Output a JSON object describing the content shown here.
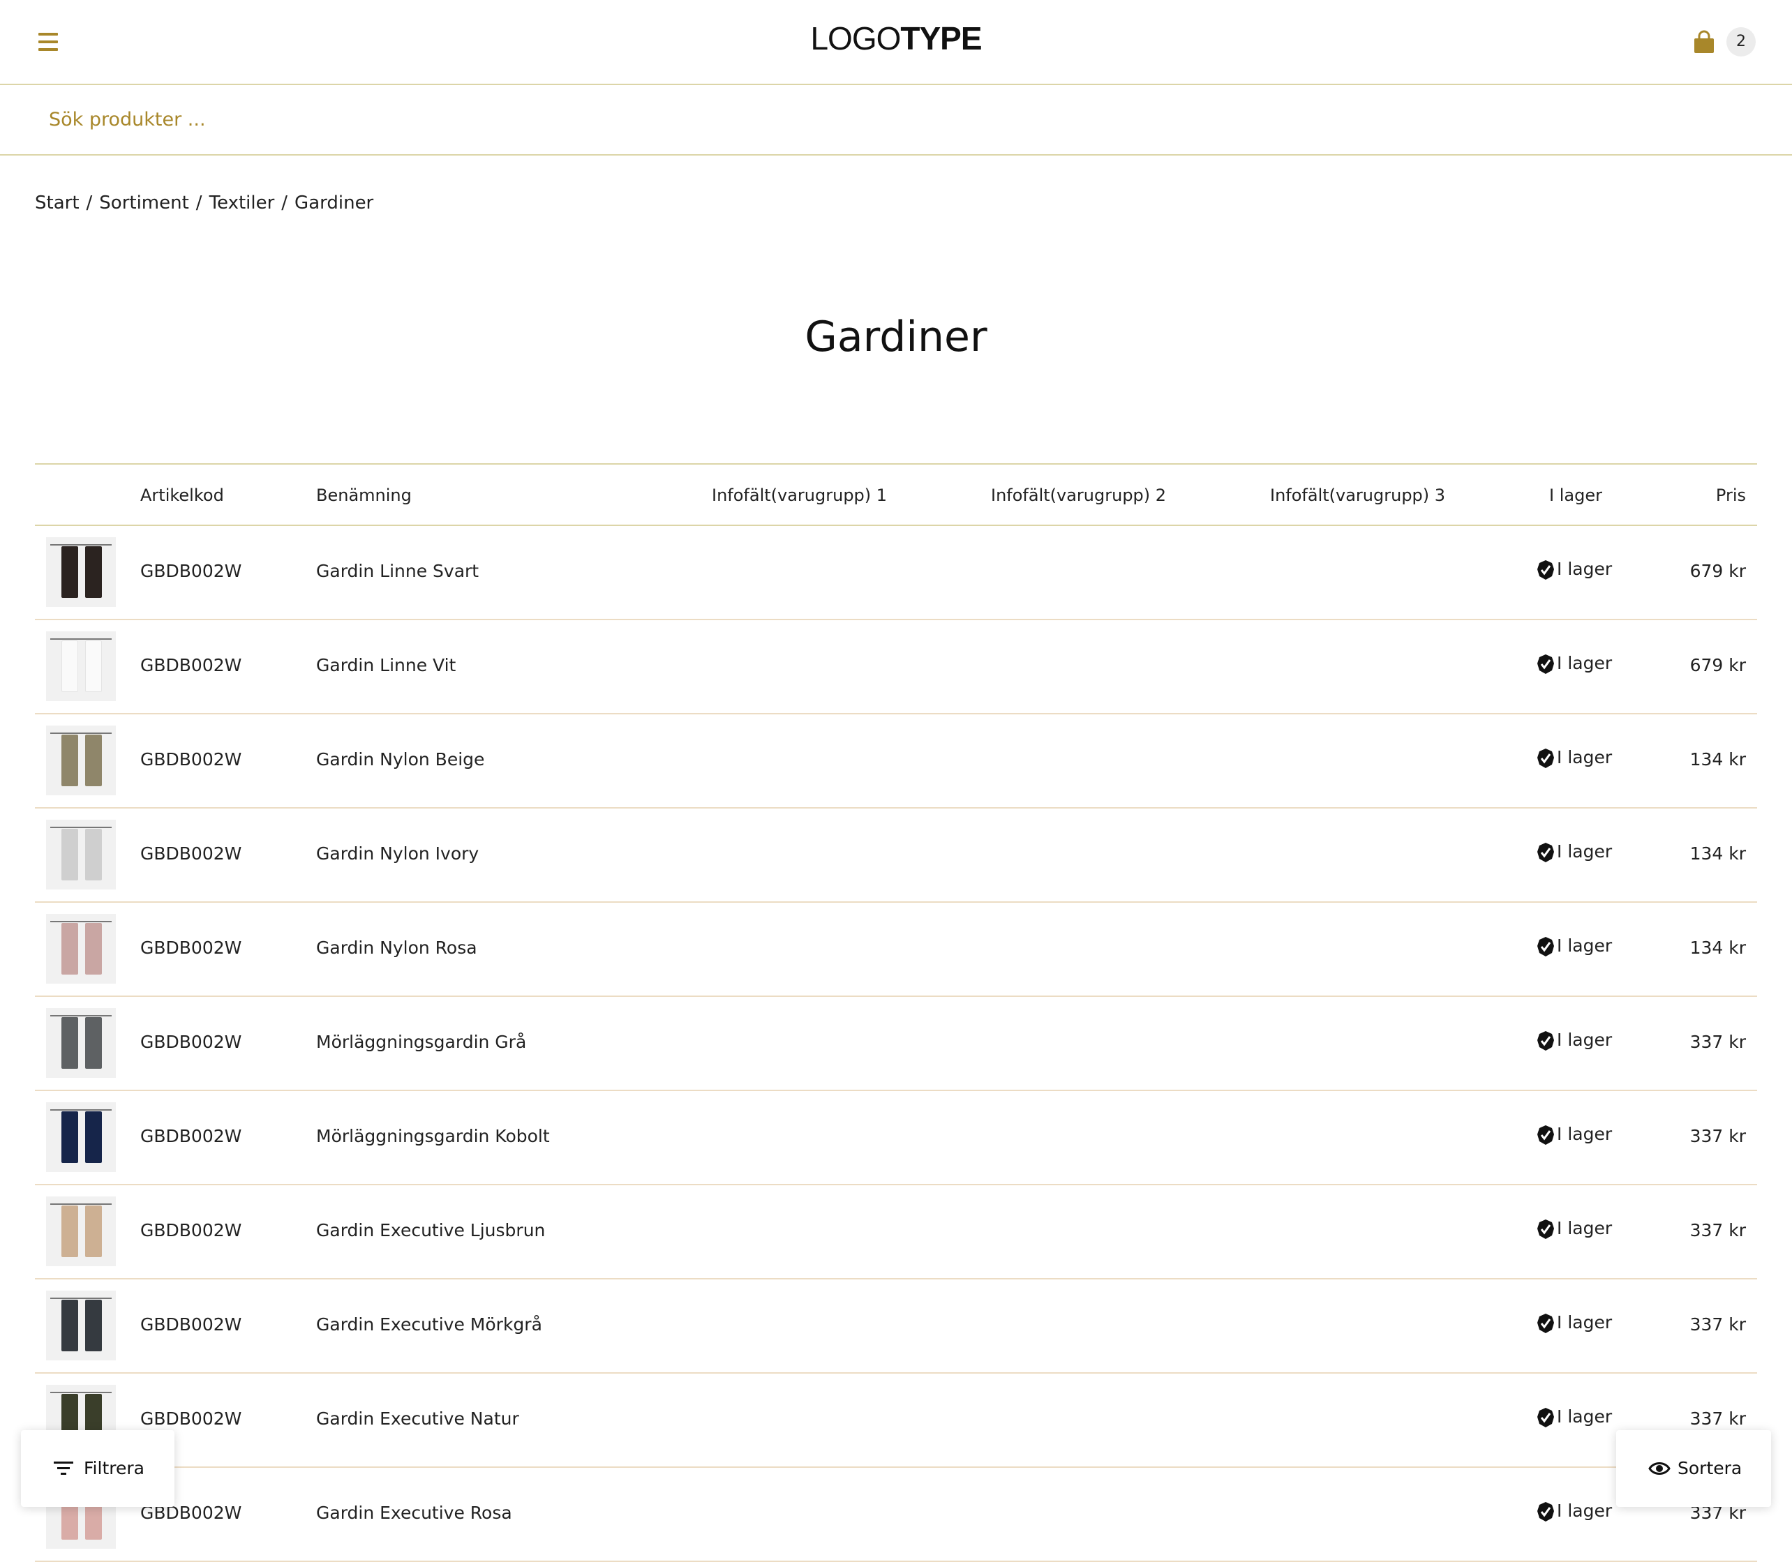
{
  "header": {
    "logo_light": "LOGO",
    "logo_bold": "TYPE",
    "cart_count": "2",
    "accent_color": "#a8872a"
  },
  "search": {
    "placeholder": "Sök produkter ..."
  },
  "breadcrumb": [
    "Start",
    "Sortiment",
    "Textiler",
    "Gardiner"
  ],
  "page_title": "Gardiner",
  "table": {
    "columns": [
      "Artikelkod",
      "Benämning",
      "Infofält(varugrupp) 1",
      "Infofält(varugrupp) 2",
      "Infofält(varugrupp) 3",
      "I lager",
      "Pris"
    ],
    "rows": [
      {
        "code": "GBDB002W",
        "name": "Gardin Linne Svart",
        "stock": "I lager",
        "price": "679 kr",
        "thumb_color": "#2b2320"
      },
      {
        "code": "GBDB002W",
        "name": "Gardin Linne Vit",
        "stock": "I lager",
        "price": "679 kr",
        "thumb_color": "#fafafa"
      },
      {
        "code": "GBDB002W",
        "name": "Gardin Nylon Beige",
        "stock": "I lager",
        "price": "134 kr",
        "thumb_color": "#8f866a"
      },
      {
        "code": "GBDB002W",
        "name": "Gardin Nylon Ivory",
        "stock": "I lager",
        "price": "134 kr",
        "thumb_color": "#cfcfcf"
      },
      {
        "code": "GBDB002W",
        "name": "Gardin Nylon Rosa",
        "stock": "I lager",
        "price": "134 kr",
        "thumb_color": "#c9a6a3"
      },
      {
        "code": "GBDB002W",
        "name": "Mörläggningsgardin Grå",
        "stock": "I lager",
        "price": "337 kr",
        "thumb_color": "#5e6163"
      },
      {
        "code": "GBDB002W",
        "name": "Mörläggningsgardin Kobolt",
        "stock": "I lager",
        "price": "337 kr",
        "thumb_color": "#16254a"
      },
      {
        "code": "GBDB002W",
        "name": "Gardin Executive Ljusbrun",
        "stock": "I lager",
        "price": "337 kr",
        "thumb_color": "#cdb093"
      },
      {
        "code": "GBDB002W",
        "name": "Gardin Executive Mörkgrå",
        "stock": "I lager",
        "price": "337 kr",
        "thumb_color": "#353a40"
      },
      {
        "code": "GBDB002W",
        "name": "Gardin Executive Natur",
        "stock": "I lager",
        "price": "337 kr",
        "thumb_color": "#3a3e2a"
      },
      {
        "code": "GBDB002W",
        "name": "Gardin Executive Rosa",
        "stock": "I lager",
        "price": "337 kr",
        "thumb_color": "#d9aca7"
      }
    ]
  },
  "actions": {
    "filter_label": "Filtrera",
    "sort_label": "Sortera"
  },
  "icons": {
    "menu": "hamburger-icon",
    "cart": "shopping-bag-icon",
    "stock": "check-badge-icon",
    "filter": "filter-lines-icon",
    "sort": "eye-icon"
  }
}
